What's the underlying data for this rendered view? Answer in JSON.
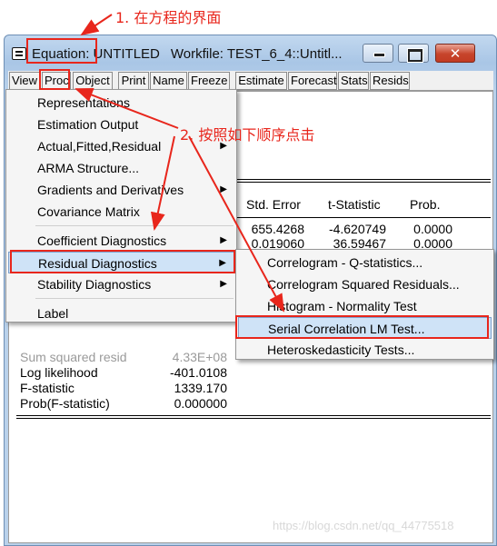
{
  "annotations": {
    "step1": "1. 在方程的界面",
    "step2": "2. 按照如下顺序点击"
  },
  "window": {
    "title_equation": "Equation: UNTITLED",
    "title_workfile": "Workfile: TEST_6_4::Untitl..."
  },
  "toolbar": {
    "buttons": [
      "View",
      "Proc",
      "Object",
      "Print",
      "Name",
      "Freeze",
      "Estimate",
      "Forecast",
      "Stats",
      "Resids"
    ]
  },
  "output": {
    "headers": [
      "Std. Error",
      "t-Statistic",
      "Prob."
    ],
    "rows": [
      [
        "655.4268",
        "-4.620749",
        "0.0000"
      ],
      [
        "0.019060",
        "36.59467",
        "0.0000"
      ]
    ],
    "stats": [
      {
        "label": "Sum squared resid",
        "value": "4.33E+08"
      },
      {
        "label": "Log likelihood",
        "value": "-401.0108"
      },
      {
        "label": "F-statistic",
        "value": "1339.170"
      },
      {
        "label": "Prob(F-statistic)",
        "value": "0.000000"
      }
    ]
  },
  "proc_menu": {
    "items": [
      {
        "label": "Representations",
        "submenu": false
      },
      {
        "label": "Estimation Output",
        "submenu": false
      },
      {
        "label": "Actual,Fitted,Residual",
        "submenu": true
      },
      {
        "label": "ARMA Structure...",
        "submenu": false
      },
      {
        "label": "Gradients and Derivatives",
        "submenu": true
      },
      {
        "label": "Covariance Matrix",
        "submenu": false
      },
      {
        "label": "Coefficient Diagnostics",
        "submenu": true
      },
      {
        "label": "Residual Diagnostics",
        "submenu": true,
        "selected": true
      },
      {
        "label": "Stability Diagnostics",
        "submenu": true
      },
      {
        "label": "Label",
        "submenu": false
      }
    ]
  },
  "residual_submenu": {
    "items": [
      {
        "label": "Correlogram - Q-statistics..."
      },
      {
        "label": "Correlogram Squared Residuals..."
      },
      {
        "label": "Histogram - Normality Test"
      },
      {
        "label": "Serial Correlation LM Test...",
        "selected": true
      },
      {
        "label": "Heteroskedasticity Tests..."
      }
    ]
  },
  "watermark": "https://blog.csdn.net/qq_44775518",
  "colors": {
    "annotation": "#e8261c",
    "selection": "#cfe3f7"
  }
}
